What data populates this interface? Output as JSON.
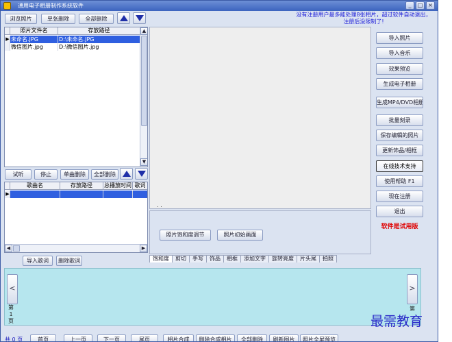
{
  "window": {
    "title": "通用电子相册制作系统软件",
    "controls": [
      "_",
      "□",
      "×"
    ]
  },
  "photo_toolbar": {
    "browse": "浏览照片",
    "delete_single": "单张删除",
    "delete_all": "全部删除"
  },
  "notice": "没有注册用户最多能处理8张相片，超过软件自动退出，注册后没限制了!",
  "photo_table": {
    "columns": [
      "照片文件名",
      "存放路径"
    ],
    "rows": [
      {
        "marker": "▶",
        "name": "未命名.JPG",
        "path": "D:\\未命名.JPG",
        "selected": true
      },
      {
        "marker": "",
        "name": "微信图片.jpg",
        "path": "D:\\微信图片.jpg",
        "selected": false
      }
    ]
  },
  "music_toolbar": {
    "listen": "试听",
    "stop": "停止",
    "delete_single": "单曲删除",
    "delete_all": "全部删除"
  },
  "music_table": {
    "columns": [
      "歌曲名",
      "存放路径",
      "总播放时间",
      "歌词"
    ],
    "rows": [
      {
        "marker": "▶",
        "name": "",
        "path": "",
        "duration": "",
        "lyrics": "",
        "selected": true
      }
    ]
  },
  "lyrics_buttons": {
    "import": "导入歌词",
    "delete": "删除歌词"
  },
  "preview_panel": {
    "saturation": "照片饱和度调节",
    "initial": "照片初始画面",
    "dots": ". ."
  },
  "tabs": [
    "饱和度",
    "剪切",
    "手写",
    "饰品",
    "相框",
    "添加文字",
    "旋转亮度",
    "片头尾",
    "拍照"
  ],
  "right_buttons": [
    "导入照片",
    "导入音乐",
    "效果预览",
    "生成电子相册",
    "生成MP4/DVD相册",
    "批量刻录",
    "保存编辑的照片",
    "更新饰品/相框",
    "在线技术支持",
    "使用帮助  F1",
    "现在注册",
    "退出"
  ],
  "trial_label": "软件是试用版",
  "page_indicator": {
    "left": "第\n1\n页",
    "right": "第"
  },
  "bottom_bar": {
    "count": "共 0 页",
    "buttons": [
      "首页",
      "上一页",
      "下一页",
      "尾页",
      "相片合成",
      "删除合成相片",
      "全部删除",
      "刷新图片",
      "照片全屏预览"
    ]
  },
  "watermark": "最需教育",
  "colors": {
    "window_bg": "#dbe3f1",
    "title_bar": "#3c64bf",
    "selection": "#2f5fe0",
    "notice": "#1a1ad8",
    "trial": "#e00000",
    "thumb_strip": "#b6e6ee"
  }
}
